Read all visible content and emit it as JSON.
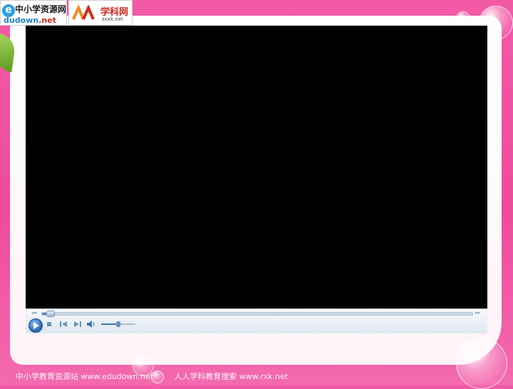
{
  "logos": {
    "left": {
      "brand": "中小学资源网",
      "domain": "dudown",
      "tld": ".net",
      "icon": "e-logo-icon"
    },
    "right": {
      "brand": "学科网",
      "domain": "zxxk.net",
      "icon": "people-logo-icon"
    }
  },
  "player": {
    "play_icon": "play-icon",
    "stop_icon": "stop-icon",
    "prev_icon": "previous-icon",
    "next_icon": "next-icon",
    "volume_icon": "volume-icon",
    "seek_progress": 0.01,
    "volume_level": 0.5,
    "rewind_glyph": "◂◂",
    "forward_glyph": "▸▸"
  },
  "footer": {
    "left": "中小学教育资源站 www.edudown.net",
    "right": "人人学科教育搜索 www.rxk.net"
  },
  "colors": {
    "background": "#f04a9c",
    "player": "#000000",
    "accent": "#2e6db7"
  }
}
